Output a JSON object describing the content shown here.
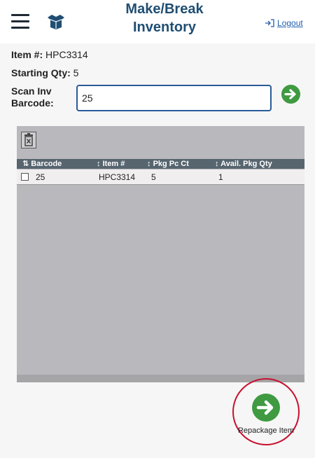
{
  "header": {
    "title_line1": "Make/Break",
    "title_line2": "Inventory",
    "logout_label": "Logout"
  },
  "info": {
    "item_label": "Item #:",
    "item_value": "HPC3314",
    "starting_qty_label": "Starting Qty:",
    "starting_qty_value": "5"
  },
  "scan": {
    "label_line1": "Scan Inv",
    "label_line2": "Barcode:",
    "value": "25"
  },
  "grid": {
    "columns": [
      {
        "label": "Barcode",
        "sort_icon": "sort-asc-icon"
      },
      {
        "label": "Item #",
        "sort_icon": "sort-icon"
      },
      {
        "label": "Pkg Pc Ct",
        "sort_icon": "sort-icon"
      },
      {
        "label": "Avail. Pkg Qty",
        "sort_icon": "sort-icon"
      }
    ],
    "rows": [
      {
        "barcode": "25",
        "item": "HPC3314",
        "pkg_pc_ct": "5",
        "avail_pkg_qty": "1"
      }
    ]
  },
  "actions": {
    "repackage_label": "Repackage Item"
  },
  "colors": {
    "title": "#1f4e72",
    "accent_green": "#3f9a42",
    "grid_header": "#57656f",
    "grid_panel": "#b9b8bd",
    "highlight_ring": "#c8102e",
    "input_border": "#2a5b9a"
  }
}
